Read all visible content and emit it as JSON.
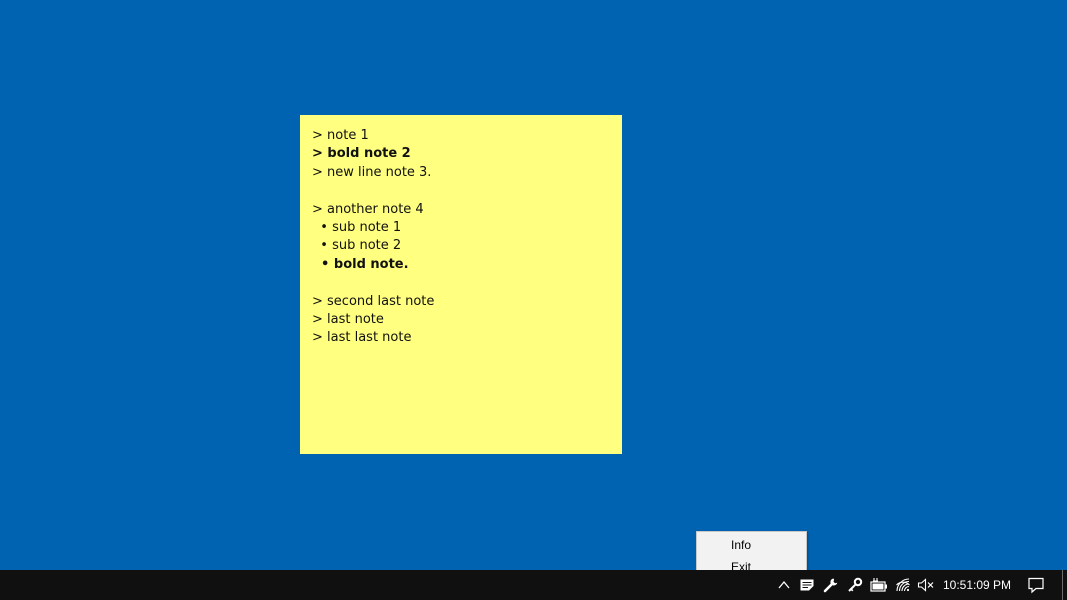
{
  "desktop": {
    "background_color": "#0063b1"
  },
  "sticky_note": {
    "background_color": "#ffff80",
    "lines": [
      {
        "text": "> note 1",
        "bold": false
      },
      {
        "text": "> bold note 2",
        "bold": true
      },
      {
        "text": "> new line note 3.",
        "bold": false
      },
      {
        "text": "",
        "bold": false
      },
      {
        "text": "> another note 4",
        "bold": false
      },
      {
        "text": "  • sub note 1",
        "bold": false
      },
      {
        "text": "  • sub note 2",
        "bold": false
      },
      {
        "text": "  • bold note.",
        "bold": true
      },
      {
        "text": "",
        "bold": false
      },
      {
        "text": "> second last note",
        "bold": false
      },
      {
        "text": "> last note",
        "bold": false
      },
      {
        "text": "> last last note",
        "bold": false
      }
    ]
  },
  "context_menu": {
    "items": [
      {
        "label": "Info"
      },
      {
        "label": "Exit"
      }
    ]
  },
  "taskbar": {
    "tray_icons": [
      "chevron-up-icon",
      "sticky-notes-app-icon",
      "wrench-icon",
      "key-icon",
      "battery-charging-icon",
      "wifi-icon",
      "volume-muted-icon"
    ],
    "clock": "10:51:09 PM",
    "notification_icon": "action-center-icon"
  }
}
